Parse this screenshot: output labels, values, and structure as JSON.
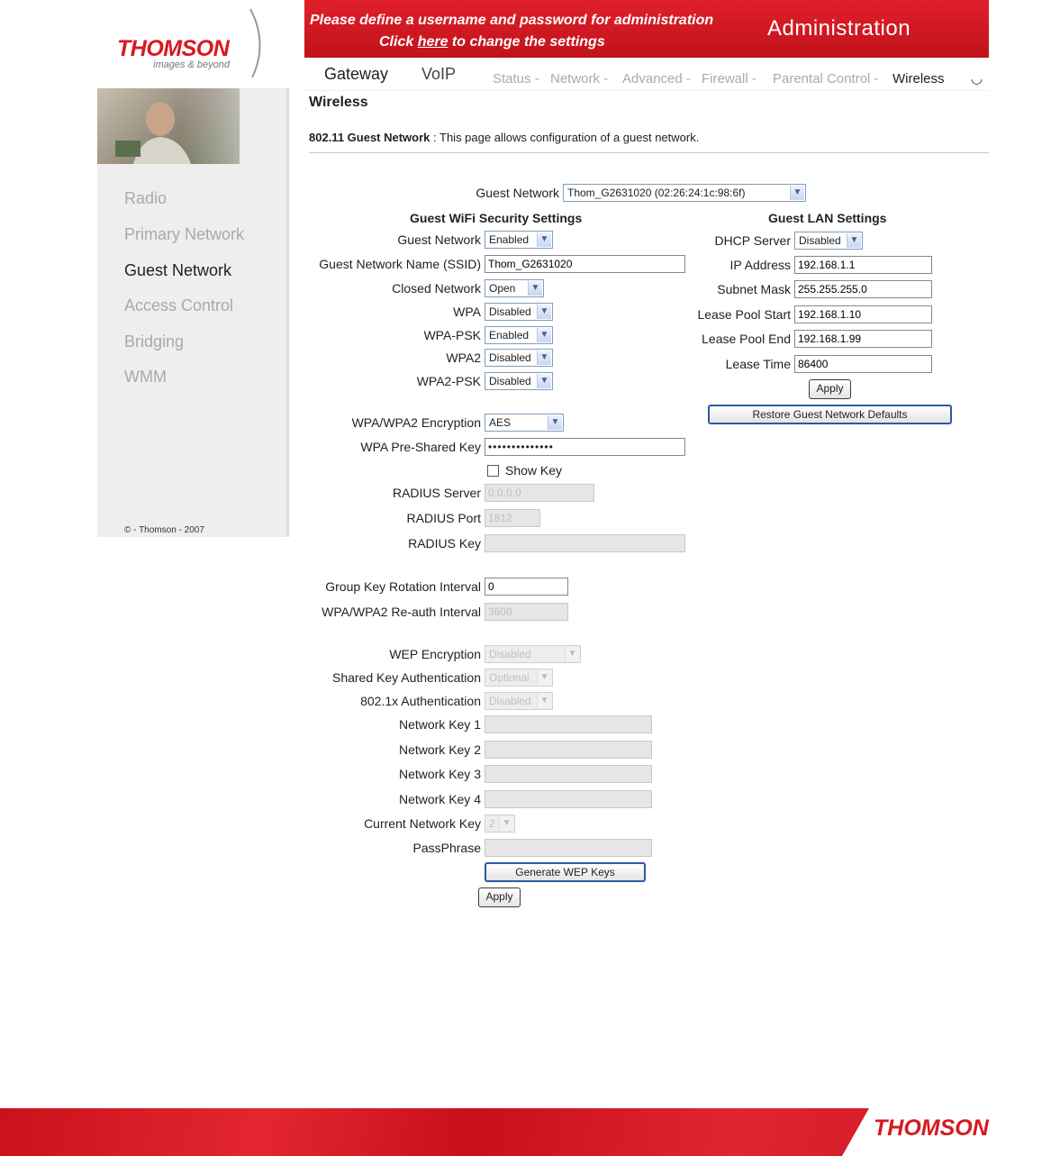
{
  "brand": {
    "logo": "THOMSON",
    "tagline": "images & beyond",
    "footer_logo": "THOMSON"
  },
  "banner": {
    "line1": "Please define a username and password for administration",
    "line2_pre": "Click ",
    "line2_link": "here",
    "line2_post": " to change the settings",
    "title": "Administration"
  },
  "nav": {
    "main": [
      "Gateway",
      "VoIP"
    ],
    "sub": [
      "Status -",
      "Network -",
      "Advanced -",
      "Firewall -",
      "Parental Control -",
      "Wireless"
    ]
  },
  "sidebar": {
    "items": [
      "Radio",
      "Primary Network",
      "Guest Network",
      "Access Control",
      "Bridging",
      "WMM"
    ],
    "copyright": "© - Thomson - 2007"
  },
  "page": {
    "title": "Wireless",
    "desc_bold": "802.11 Guest Network",
    "desc": " :  This page allows configuration of a guest network."
  },
  "guest_selector": {
    "label": "Guest Network",
    "value": "Thom_G2631020 (02:26:24:1c:98:6f)"
  },
  "security": {
    "header": "Guest WiFi Security Settings",
    "guest_network": {
      "label": "Guest Network",
      "value": "Enabled"
    },
    "ssid": {
      "label": "Guest Network Name (SSID)",
      "value": "Thom_G2631020"
    },
    "closed_network": {
      "label": "Closed Network",
      "value": "Open"
    },
    "wpa": {
      "label": "WPA",
      "value": "Disabled"
    },
    "wpa_psk": {
      "label": "WPA-PSK",
      "value": "Enabled"
    },
    "wpa2": {
      "label": "WPA2",
      "value": "Disabled"
    },
    "wpa2_psk": {
      "label": "WPA2-PSK",
      "value": "Disabled"
    },
    "encryption": {
      "label": "WPA/WPA2 Encryption",
      "value": "AES"
    },
    "psk": {
      "label": "WPA Pre-Shared Key",
      "value": "••••••••••••••"
    },
    "show_key": "Show Key",
    "radius_server": {
      "label": "RADIUS Server",
      "value": "0.0.0.0"
    },
    "radius_port": {
      "label": "RADIUS Port",
      "value": "1812"
    },
    "radius_key": {
      "label": "RADIUS Key",
      "value": ""
    },
    "group_key": {
      "label": "Group Key Rotation Interval",
      "value": "0"
    },
    "reauth": {
      "label": "WPA/WPA2 Re-auth Interval",
      "value": "3600"
    },
    "wep_encryption": {
      "label": "WEP Encryption",
      "value": "Disabled"
    },
    "shared_key_auth": {
      "label": "Shared Key Authentication",
      "value": "Optional"
    },
    "dot1x_auth": {
      "label": "802.1x Authentication",
      "value": "Disabled"
    },
    "network_keys": [
      "Network Key 1",
      "Network Key 2",
      "Network Key 3",
      "Network Key 4"
    ],
    "current_key": {
      "label": "Current Network Key",
      "value": "2"
    },
    "passphrase": {
      "label": "PassPhrase",
      "value": ""
    },
    "generate_button": "Generate WEP Keys",
    "apply_button": "Apply"
  },
  "lan": {
    "header": "Guest LAN Settings",
    "dhcp": {
      "label": "DHCP Server",
      "value": "Disabled"
    },
    "ip": {
      "label": "IP Address",
      "value": "192.168.1.1"
    },
    "subnet": {
      "label": "Subnet Mask",
      "value": "255.255.255.0"
    },
    "pool_start": {
      "label": "Lease Pool Start",
      "value": "192.168.1.10"
    },
    "pool_end": {
      "label": "Lease Pool End",
      "value": "192.168.1.99"
    },
    "lease_time": {
      "label": "Lease Time",
      "value": "86400"
    },
    "apply_button": "Apply",
    "restore_button": "Restore Guest Network Defaults"
  }
}
